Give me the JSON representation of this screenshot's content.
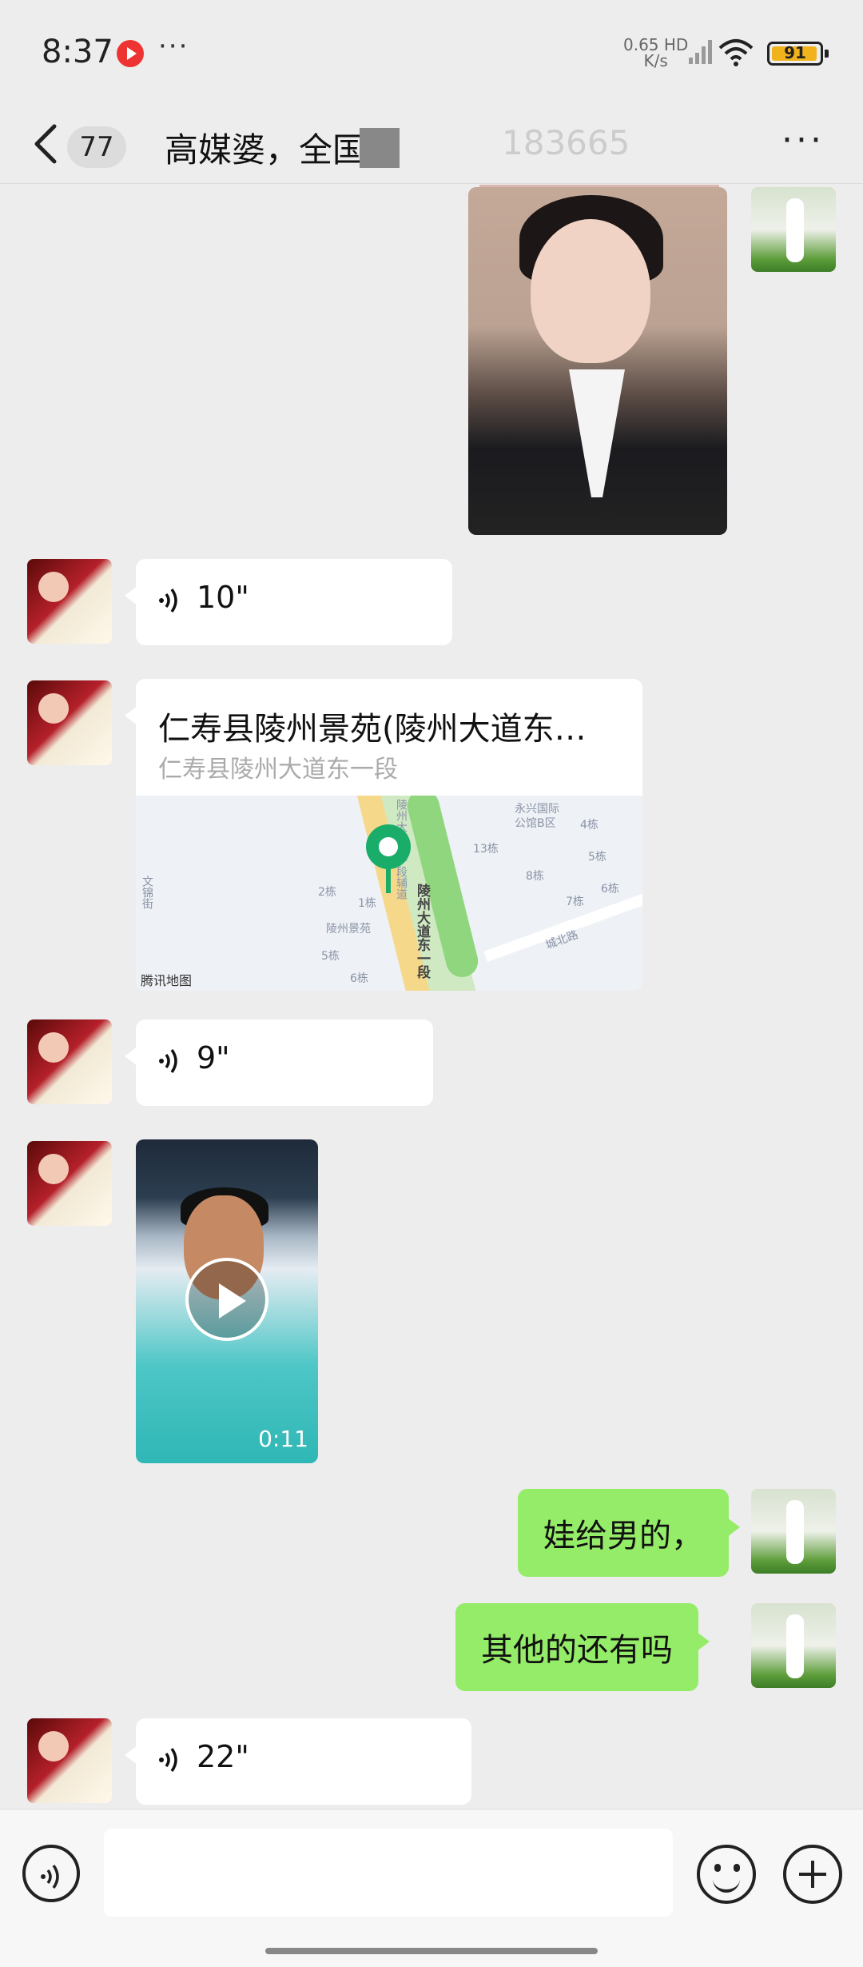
{
  "status_bar": {
    "time": "8:37",
    "net_speed": "0.65 HD\nK/s",
    "battery": "91",
    "icons": [
      "recording-icon",
      "more-status-icon",
      "signal-icon",
      "wifi-icon",
      "battery-icon"
    ]
  },
  "header": {
    "back_icon": "chevron-left-icon",
    "unread_count": "77",
    "title": "高媒婆，全国",
    "title_suffix": "183665",
    "more_label": "···"
  },
  "messages": [
    {
      "type": "image",
      "sender": "me"
    },
    {
      "type": "voice",
      "sender": "her",
      "duration": "10\""
    },
    {
      "type": "location",
      "sender": "her",
      "title": "仁寿县陵州景苑(陵州大道东…",
      "address": "仁寿县陵州大道东一段",
      "map_labels": [
        "永兴国际",
        "公馆B区",
        "4栋",
        "13栋",
        "5栋",
        "8栋",
        "6栋",
        "7栋",
        "2栋",
        "1栋",
        "陵州景苑",
        "5栋",
        "6栋",
        "文锦街",
        "城北路",
        "陵州大道东一段",
        "陵州大道东一段辅道"
      ],
      "map_credit": "腾讯地图"
    },
    {
      "type": "voice",
      "sender": "her",
      "duration": "9\""
    },
    {
      "type": "video",
      "sender": "her",
      "duration": "0:11"
    },
    {
      "type": "text",
      "sender": "me",
      "text": "娃给男的，"
    },
    {
      "type": "text",
      "sender": "me",
      "text": "其他的还有吗"
    },
    {
      "type": "voice",
      "sender": "her",
      "duration": "22\""
    }
  ],
  "input_bar": {
    "placeholder": "",
    "icons": [
      "voice-mode-icon",
      "emoji-icon",
      "plus-icon"
    ]
  },
  "colors": {
    "background": "#ededed",
    "my_bubble": "#95ec69",
    "their_bubble": "#ffffff",
    "pin": "#1aad6a"
  }
}
